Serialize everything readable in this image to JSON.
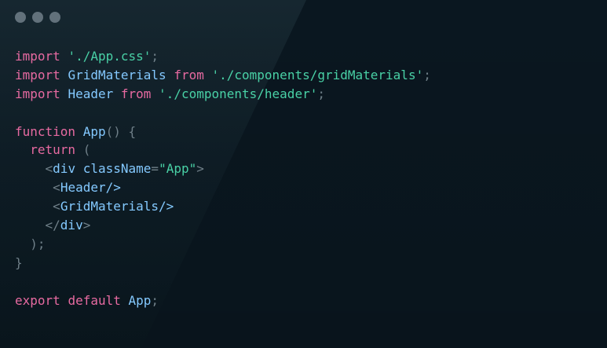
{
  "code": {
    "lines": [
      [
        {
          "t": "import",
          "c": "kw"
        },
        {
          "t": " ",
          "c": "plain"
        },
        {
          "t": "'./App.css'",
          "c": "str"
        },
        {
          "t": ";",
          "c": "punc"
        }
      ],
      [
        {
          "t": "import",
          "c": "kw"
        },
        {
          "t": " ",
          "c": "plain"
        },
        {
          "t": "GridMaterials",
          "c": "id"
        },
        {
          "t": " ",
          "c": "plain"
        },
        {
          "t": "from",
          "c": "kw"
        },
        {
          "t": " ",
          "c": "plain"
        },
        {
          "t": "'./components/gridMaterials'",
          "c": "str"
        },
        {
          "t": ";",
          "c": "punc"
        }
      ],
      [
        {
          "t": "import",
          "c": "kw"
        },
        {
          "t": " ",
          "c": "plain"
        },
        {
          "t": "Header",
          "c": "id"
        },
        {
          "t": " ",
          "c": "plain"
        },
        {
          "t": "from",
          "c": "kw"
        },
        {
          "t": " ",
          "c": "plain"
        },
        {
          "t": "'./components/header'",
          "c": "str"
        },
        {
          "t": ";",
          "c": "punc"
        }
      ],
      [],
      [
        {
          "t": "function",
          "c": "kw"
        },
        {
          "t": " ",
          "c": "plain"
        },
        {
          "t": "App",
          "c": "id"
        },
        {
          "t": "() {",
          "c": "punc"
        }
      ],
      [
        {
          "t": "  ",
          "c": "plain"
        },
        {
          "t": "return",
          "c": "kw"
        },
        {
          "t": " (",
          "c": "punc"
        }
      ],
      [
        {
          "t": "    ",
          "c": "plain"
        },
        {
          "t": "<",
          "c": "punc"
        },
        {
          "t": "div",
          "c": "tag"
        },
        {
          "t": " ",
          "c": "plain"
        },
        {
          "t": "className",
          "c": "attr"
        },
        {
          "t": "=",
          "c": "punc"
        },
        {
          "t": "\"App\"",
          "c": "str"
        },
        {
          "t": ">",
          "c": "punc"
        }
      ],
      [
        {
          "t": "     ",
          "c": "plain"
        },
        {
          "t": "<",
          "c": "punc"
        },
        {
          "t": "Header",
          "c": "tag"
        },
        {
          "t": "/>",
          "c": "tag"
        }
      ],
      [
        {
          "t": "     ",
          "c": "plain"
        },
        {
          "t": "<",
          "c": "punc"
        },
        {
          "t": "GridMaterials",
          "c": "tag"
        },
        {
          "t": "/>",
          "c": "tag"
        }
      ],
      [
        {
          "t": "    ",
          "c": "plain"
        },
        {
          "t": "</",
          "c": "punc"
        },
        {
          "t": "div",
          "c": "tag"
        },
        {
          "t": ">",
          "c": "punc"
        }
      ],
      [
        {
          "t": "  ",
          "c": "plain"
        },
        {
          "t": ");",
          "c": "punc"
        }
      ],
      [
        {
          "t": "}",
          "c": "punc"
        }
      ],
      [],
      [
        {
          "t": "export",
          "c": "kw"
        },
        {
          "t": " ",
          "c": "plain"
        },
        {
          "t": "default",
          "c": "kw"
        },
        {
          "t": " ",
          "c": "plain"
        },
        {
          "t": "App",
          "c": "id"
        },
        {
          "t": ";",
          "c": "punc"
        }
      ]
    ]
  },
  "icons": [
    "window-control-icon",
    "window-control-icon",
    "window-control-icon"
  ],
  "colors": {
    "background": "#0a1720",
    "keyword": "#e76aa1",
    "string": "#49d1a6",
    "identifier": "#84c9ff",
    "punctuation": "#6f7f88",
    "text": "#d4dde3",
    "window_control": "#62717b"
  }
}
